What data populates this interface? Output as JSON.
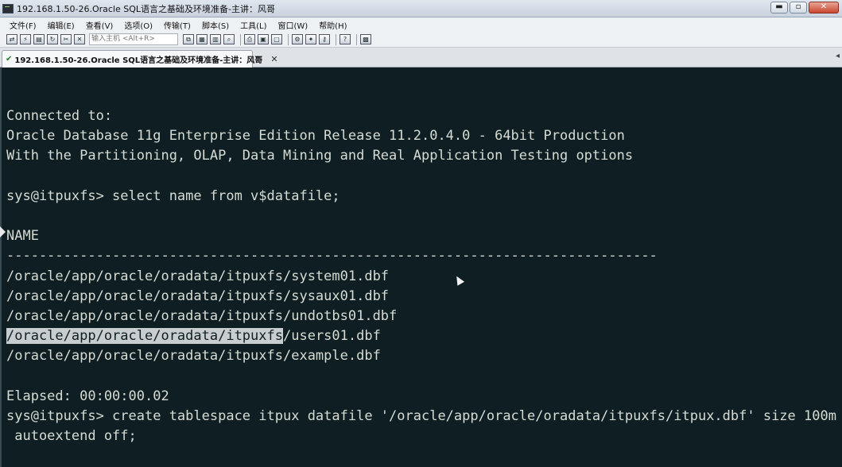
{
  "window": {
    "title": "192.168.1.50-26.Oracle SQL语言之基础及环境准备-主讲：风哥",
    "minimize": "▬",
    "maximize": "▫",
    "close": "✕"
  },
  "menu": {
    "items": [
      "文件(F)",
      "编辑(E)",
      "查看(V)",
      "选项(O)",
      "传输(T)",
      "脚本(S)",
      "工具(L)",
      "窗口(W)",
      "帮助(H)"
    ]
  },
  "toolbar": {
    "host_placeholder": "输入主机 <Alt+R>"
  },
  "tab": {
    "label": "192.168.1.50-26.Oracle SQL语言之基础及环境准备-主讲：风哥",
    "close": "✕"
  },
  "terminal": {
    "lines": [
      "",
      "",
      "Connected to:",
      "Oracle Database 11g Enterprise Edition Release 11.2.0.4.0 - 64bit Production",
      "With the Partitioning, OLAP, Data Mining and Real Application Testing options",
      "",
      "sys@itpuxfs> select name from v$datafile;",
      "",
      "NAME",
      "--------------------------------------------------------------------------------",
      "/oracle/app/oracle/oradata/itpuxfs/system01.dbf",
      "/oracle/app/oracle/oradata/itpuxfs/sysaux01.dbf",
      "/oracle/app/oracle/oradata/itpuxfs/undotbs01.dbf",
      "",
      "/oracle/app/oracle/oradata/itpuxfs/example.dbf",
      "",
      "Elapsed: 00:00:00.02",
      "sys@itpuxfs> create tablespace itpux datafile '/oracle/app/oracle/oradata/itpuxfs/itpux.dbf' size 100m",
      " autoextend off;"
    ],
    "selected_text": "/oracle/app/oracle/oradata/itpuxfs",
    "after_selected": "/users01.dbf"
  }
}
